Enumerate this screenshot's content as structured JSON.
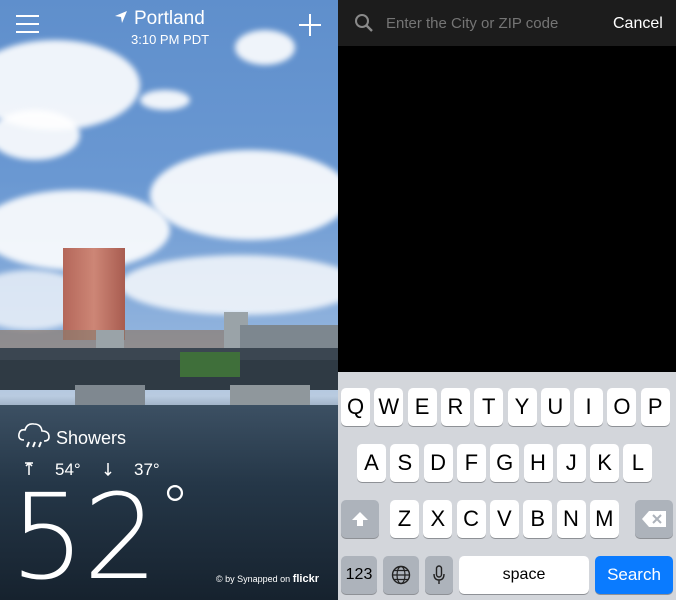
{
  "weather": {
    "city": "Portland",
    "time": "3:10 PM PDT",
    "condition": "Showers",
    "high": "54°",
    "low": "37°",
    "temperature": "52",
    "degree": "°",
    "credit": "© by Synapped on",
    "credit_brand": "flickr"
  },
  "search": {
    "placeholder": "Enter the City or ZIP code",
    "cancel_label": "Cancel"
  },
  "keyboard": {
    "row1": [
      "Q",
      "W",
      "E",
      "R",
      "T",
      "Y",
      "U",
      "I",
      "O",
      "P"
    ],
    "row2": [
      "A",
      "S",
      "D",
      "F",
      "G",
      "H",
      "J",
      "K",
      "L"
    ],
    "row3": [
      "Z",
      "X",
      "C",
      "V",
      "B",
      "N",
      "M"
    ],
    "numbers_label": "123",
    "space_label": "space",
    "search_label": "Search"
  },
  "icons": {
    "menu": "hamburger-menu-icon",
    "location": "location-arrow-icon",
    "add": "plus-icon",
    "condition": "rain-cloud-icon",
    "high": "arrow-up-icon",
    "low": "arrow-down-icon",
    "search": "magnifier-icon",
    "shift": "shift-icon",
    "backspace": "backspace-icon",
    "globe": "globe-icon",
    "mic": "microphone-icon"
  }
}
